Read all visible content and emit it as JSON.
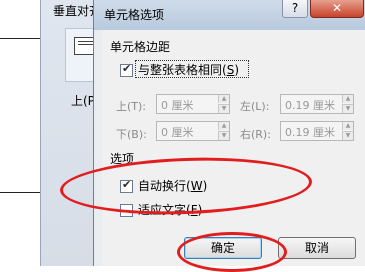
{
  "background_dialog": {
    "title_partial": "垂直对齐",
    "layout_label": "上(P"
  },
  "dialog": {
    "title": "单元格选项",
    "help_label": "?",
    "close_label": "✕",
    "margins_group": {
      "label": "单元格边距",
      "same_as_table": {
        "label": "与整张表格相同(",
        "hotkey": "S",
        "suffix": ")",
        "checked": true
      },
      "fields": [
        {
          "label": "上(T):",
          "value": "0 厘米"
        },
        {
          "label": "左(L):",
          "value": "0.19 厘米"
        },
        {
          "label": "下(B):",
          "value": "0 厘米"
        },
        {
          "label": "右(R):",
          "value": "0.19 厘米"
        }
      ]
    },
    "options_group": {
      "label": "选项",
      "wrap_text": {
        "label": "自动换行(",
        "hotkey": "W",
        "suffix": ")",
        "checked": true
      },
      "fit_text": {
        "label": "适应文字(",
        "hotkey": "F",
        "suffix": ")",
        "checked": false
      }
    },
    "ok_label": "确定",
    "cancel_label": "取消"
  },
  "colors": {
    "annotation": "#e11d1d",
    "title_bar": "#b8c9de",
    "close": "#c8432b"
  }
}
